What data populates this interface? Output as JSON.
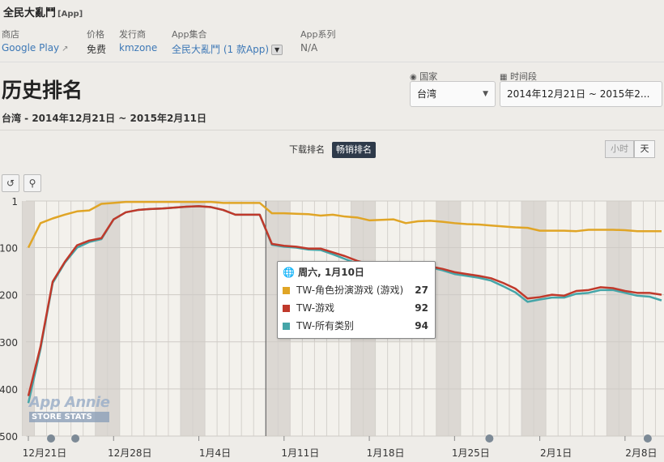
{
  "app": {
    "name": "全民大亂鬥",
    "tag": "[App]"
  },
  "meta": {
    "store_label": "商店",
    "store_value": "Google Play",
    "price_label": "价格",
    "price_value": "免费",
    "publisher_label": "发行商",
    "publisher_value": "kmzone",
    "collection_label": "App集合",
    "collection_value": "全民大亂鬥 (1 款App)",
    "series_label": "App系列",
    "series_value": "N/A"
  },
  "page": {
    "title": "历史排名",
    "subtitle": "台湾 - 2014年12月21日 ~ 2015年2月11日"
  },
  "filters": {
    "country_label": "国家",
    "country_value": "台湾",
    "period_label": "时间段",
    "period_value": "2014年12月21日 ~ 2015年2..."
  },
  "tabs": {
    "download": "下载排名",
    "grossing": "畅销排名",
    "active": "grossing"
  },
  "granularity": {
    "hour": "小时",
    "day": "天",
    "active": "day"
  },
  "icons": {
    "reset": "reset-icon",
    "zoom": "zoom-icon",
    "external": "external-link-icon",
    "globe": "globe-icon",
    "calendar": "calendar-icon"
  },
  "tooltip": {
    "date": "周六, 1月10日",
    "rows": [
      {
        "label": "TW-角色扮演游戏 (游戏)",
        "value": "27",
        "color": "#e0a526"
      },
      {
        "label": "TW-游戏",
        "value": "92",
        "color": "#c0392b"
      },
      {
        "label": "TW-所有类别",
        "value": "94",
        "color": "#45a5a8"
      }
    ]
  },
  "watermark": {
    "line1": "App Annie",
    "line2": "STORE STATS"
  },
  "chart_data": {
    "type": "line",
    "title": "",
    "ylim": [
      1,
      500
    ],
    "yaxis_inverted": true,
    "ytick_labels": [
      "1",
      "100",
      "200",
      "300",
      "400",
      "500"
    ],
    "xtick_labels": [
      "12月21日",
      "12月28日",
      "1月4日",
      "1月11日",
      "1月18日",
      "1月25日",
      "2月1日",
      "2月8日"
    ],
    "x": [
      "12-21",
      "12-22",
      "12-23",
      "12-24",
      "12-25",
      "12-26",
      "12-27",
      "12-28",
      "12-29",
      "12-30",
      "12-31",
      "01-01",
      "01-02",
      "01-03",
      "01-04",
      "01-05",
      "01-06",
      "01-07",
      "01-08",
      "01-09",
      "01-10",
      "01-11",
      "01-12",
      "01-13",
      "01-14",
      "01-15",
      "01-16",
      "01-17",
      "01-18",
      "01-19",
      "01-20",
      "01-21",
      "01-22",
      "01-23",
      "01-24",
      "01-25",
      "01-26",
      "01-27",
      "01-28",
      "01-29",
      "01-30",
      "01-31",
      "02-01",
      "02-02",
      "02-03",
      "02-04",
      "02-05",
      "02-06",
      "02-07",
      "02-08",
      "02-09",
      "02-10",
      "02-11"
    ],
    "series": [
      {
        "name": "TW-角色扮演游戏 (游戏)",
        "color": "#e0a526",
        "values": [
          100,
          48,
          38,
          30,
          23,
          21,
          7,
          5,
          3,
          3,
          3,
          3,
          3,
          3,
          3,
          3,
          5,
          5,
          5,
          5,
          27,
          27,
          28,
          29,
          32,
          30,
          34,
          36,
          42,
          41,
          40,
          48,
          44,
          43,
          45,
          48,
          50,
          51,
          53,
          55,
          57,
          58,
          64,
          64,
          64,
          65,
          62,
          62,
          62,
          63,
          65,
          65,
          65
        ]
      },
      {
        "name": "TW-游戏",
        "color": "#c0392b",
        "values": [
          415,
          310,
          172,
          130,
          95,
          85,
          80,
          40,
          25,
          20,
          18,
          17,
          15,
          13,
          12,
          14,
          20,
          30,
          30,
          30,
          92,
          96,
          98,
          102,
          102,
          110,
          118,
          128,
          135,
          135,
          132,
          140,
          140,
          140,
          145,
          152,
          156,
          160,
          165,
          175,
          187,
          208,
          205,
          200,
          202,
          192,
          190,
          184,
          186,
          192,
          196,
          196,
          200
        ]
      },
      {
        "name": "TW-所有类别",
        "color": "#45a5a8",
        "values": [
          430,
          315,
          175,
          132,
          100,
          88,
          82,
          40,
          25,
          20,
          18,
          17,
          15,
          13,
          12,
          14,
          20,
          30,
          30,
          30,
          94,
          98,
          100,
          104,
          105,
          114,
          124,
          134,
          140,
          140,
          137,
          143,
          142,
          142,
          148,
          156,
          160,
          164,
          170,
          182,
          195,
          215,
          210,
          206,
          206,
          198,
          196,
          190,
          190,
          196,
          202,
          204,
          212
        ]
      }
    ]
  }
}
